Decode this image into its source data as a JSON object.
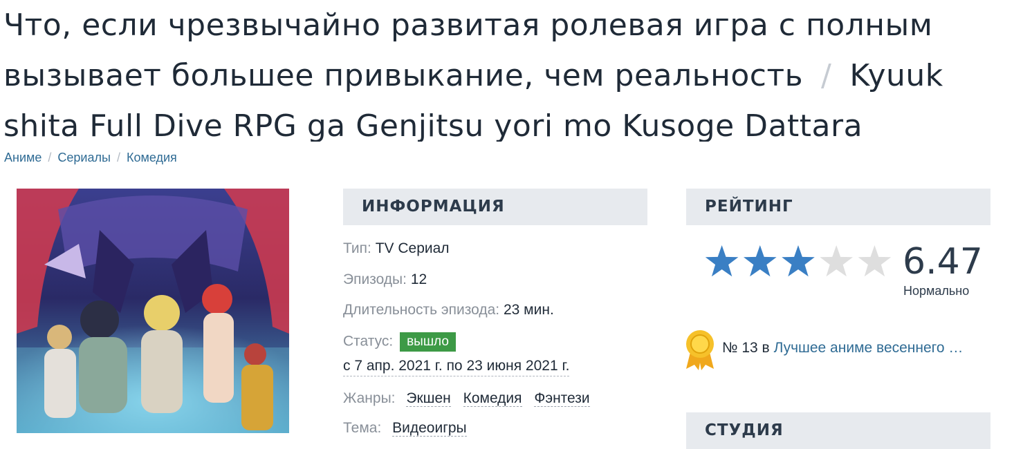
{
  "title": {
    "line1": "Что, если чрезвычайно развитая ролевая игра с полным",
    "line2_ru": "вызывает большее привыкание, чем реальность",
    "separator": "/",
    "line2_en": "Kyuuk",
    "line3": "shita Full Dive RPG ga Genjitsu yori mo Kusoge Dattara"
  },
  "breadcrumb": {
    "items": [
      "Аниме",
      "Сериалы",
      "Комедия"
    ],
    "separator": "/"
  },
  "info": {
    "heading": "ИНФОРМАЦИЯ",
    "type_label": "Тип:",
    "type_value": "TV Сериал",
    "episodes_label": "Эпизоды:",
    "episodes_value": "12",
    "duration_label": "Длительность эпизода:",
    "duration_value": "23 мин.",
    "status_label": "Статус:",
    "status_value": "вышло",
    "dates": "с 7 апр. 2021 г. по 23 июня 2021 г.",
    "genres_label": "Жанры:",
    "genres": [
      "Экшен",
      "Комедия",
      "Фэнтези"
    ],
    "theme_label": "Тема:",
    "theme_value": "Видеоигры"
  },
  "rating": {
    "heading": "РЕЙТИНГ",
    "score": "6.47",
    "score_label": "Нормально",
    "stars_filled": 3,
    "stars_total": 5,
    "star_color_filled": "#3a7fc4",
    "star_color_empty": "#dedede",
    "rank_prefix": "№ 13 в",
    "rank_link": "Лучшее аниме весеннего …"
  },
  "studio": {
    "heading": "СТУДИЯ"
  },
  "icons": {
    "medal": "award-medal-icon",
    "star": "star-icon"
  }
}
